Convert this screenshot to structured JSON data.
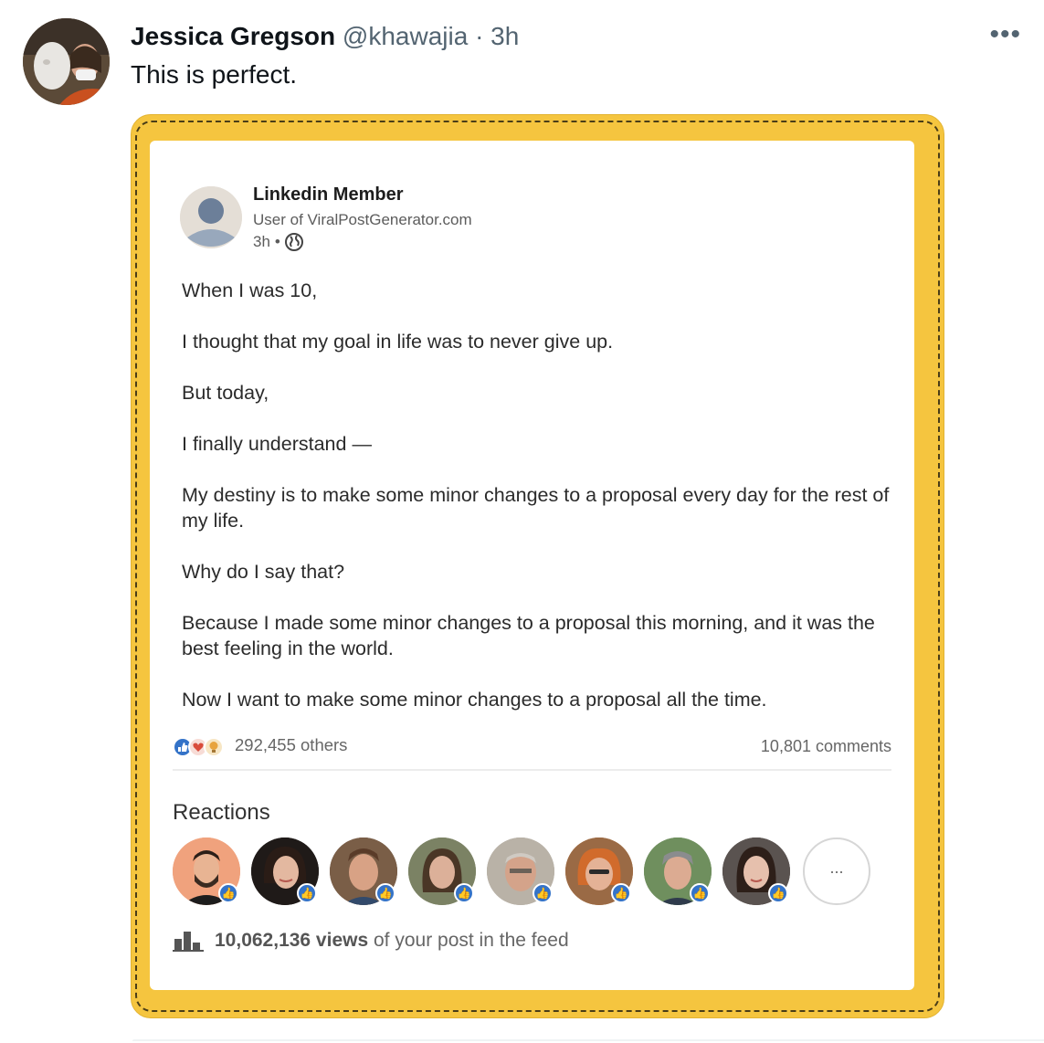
{
  "tweet": {
    "author_name": "Jessica Gregson",
    "handle": "@khawajia",
    "separator": "·",
    "time": "3h",
    "more_label": "•••",
    "text": "This is perfect."
  },
  "linkedin_post": {
    "author": "Linkedin Member",
    "subtitle": "User of ViralPostGenerator.com",
    "time": "3h",
    "meta_separator": "•",
    "visibility_icon": "globe-icon",
    "paragraphs": [
      "When I was 10,",
      "I thought that my goal in life was to never give up.",
      "But today,",
      "I finally understand —",
      "My destiny is to make some minor changes to a proposal every day for the rest of my life.",
      "Why do I say that?",
      "Because I made some minor changes to a proposal this morning, and it was the best feeling in the world.",
      "Now I want to make some minor changes to a proposal all the time."
    ],
    "reactions_summary": "292,455 others",
    "reaction_icons": [
      "like-icon",
      "love-icon",
      "insightful-icon"
    ],
    "comments": "10,801 comments",
    "reactions_title": "Reactions",
    "reactors_more": "...",
    "views_number": "10,062,136 views",
    "views_suffix": "of your post in the feed"
  },
  "colors": {
    "frame_yellow": "#f5c53f",
    "like_blue": "#3473c8",
    "love_red": "#d94c3b",
    "insight_yellow": "#e7a33e"
  }
}
